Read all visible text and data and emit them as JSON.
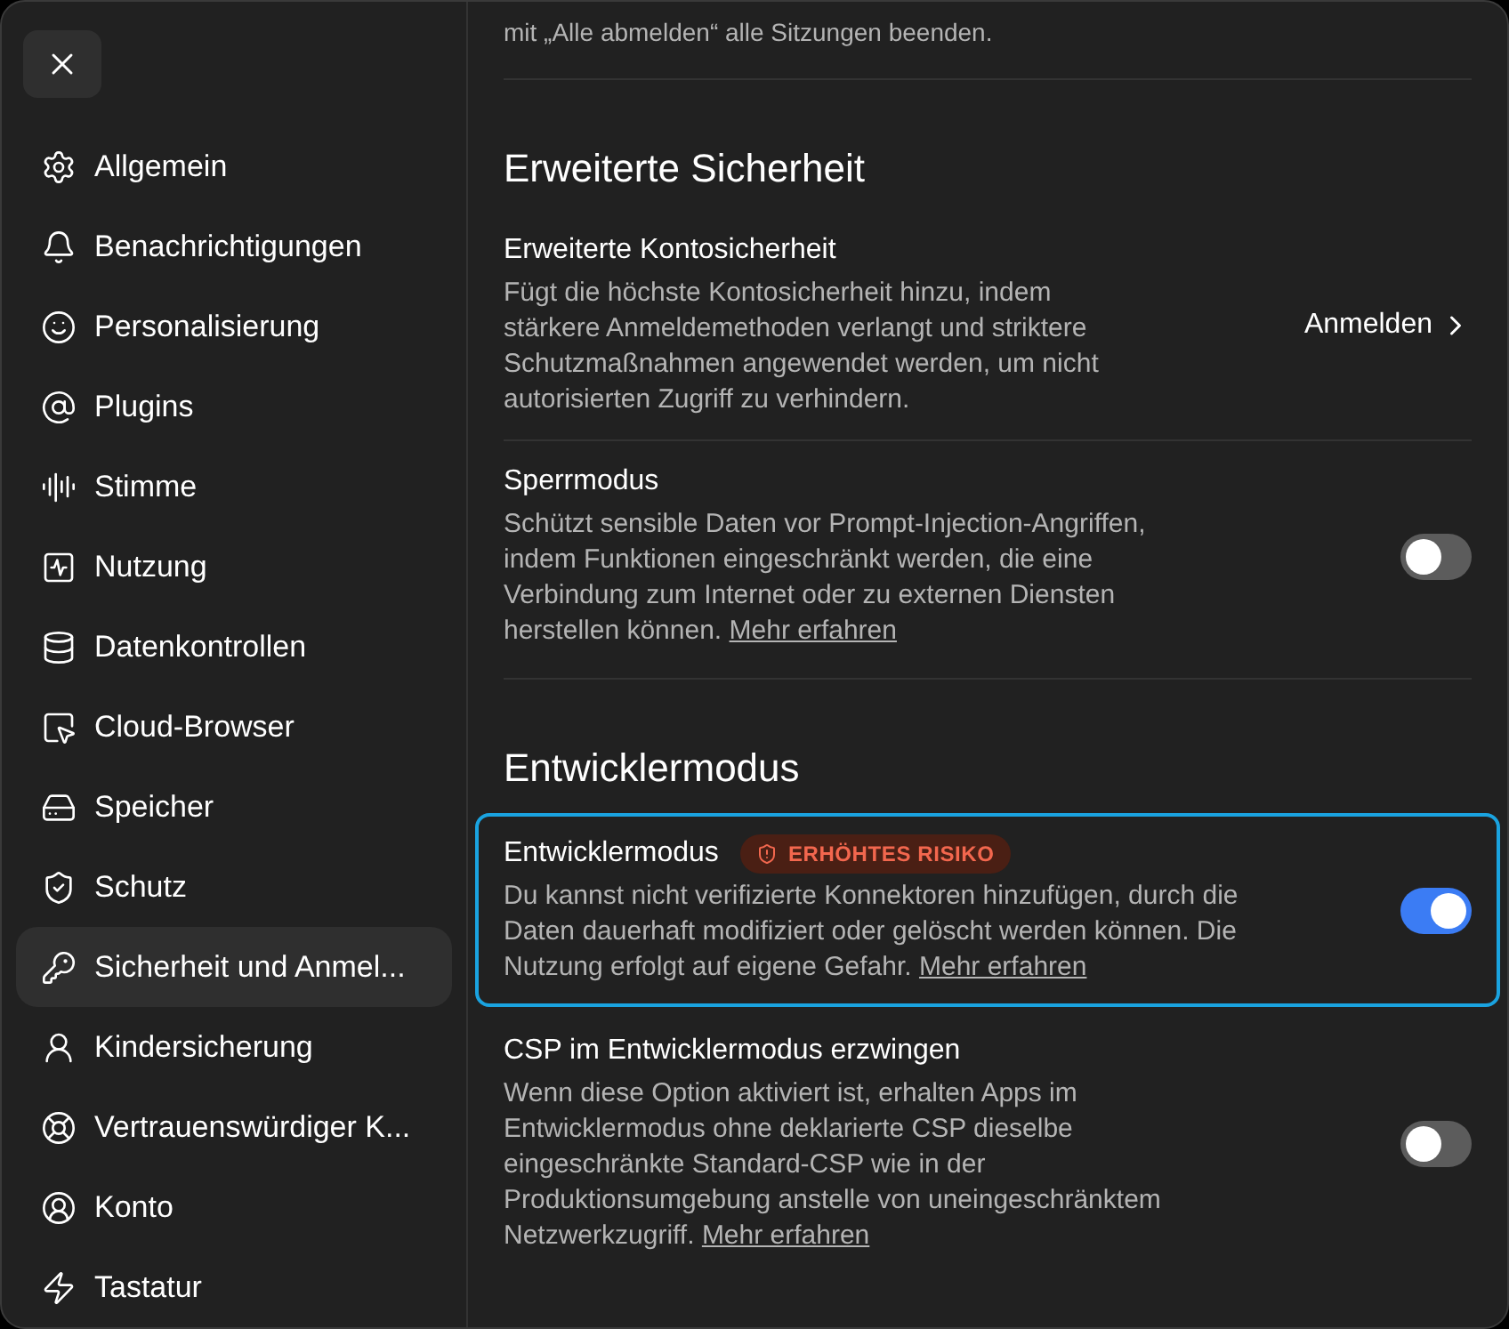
{
  "sidebar": {
    "items": [
      {
        "label": "Allgemein",
        "selected": false
      },
      {
        "label": "Benachrichtigungen",
        "selected": false
      },
      {
        "label": "Personalisierung",
        "selected": false
      },
      {
        "label": "Plugins",
        "selected": false
      },
      {
        "label": "Stimme",
        "selected": false
      },
      {
        "label": "Nutzung",
        "selected": false
      },
      {
        "label": "Datenkontrollen",
        "selected": false
      },
      {
        "label": "Cloud-Browser",
        "selected": false
      },
      {
        "label": "Speicher",
        "selected": false
      },
      {
        "label": "Schutz",
        "selected": false
      },
      {
        "label": "Sicherheit und Anmel...",
        "selected": true
      },
      {
        "label": "Kindersicherung",
        "selected": false
      },
      {
        "label": "Vertrauenswürdiger K...",
        "selected": false
      },
      {
        "label": "Konto",
        "selected": false
      },
      {
        "label": "Tastatur",
        "selected": false
      }
    ]
  },
  "top_note": "mit „Alle abmelden“ alle Sitzungen beenden.",
  "sections": [
    {
      "heading": "Erweiterte Sicherheit",
      "settings": [
        {
          "kind": "link",
          "title": "Erweiterte Kontosicherheit",
          "description": "Fügt die höchste Kontosicherheit hinzu, indem stärkere Anmeldemethoden verlangt und striktere Schutzmaßnahmen angewendet werden, um nicht autorisierten Zugriff zu verhindern.",
          "action_label": "Anmelden",
          "highlighted": false
        },
        {
          "kind": "toggle",
          "title": "Sperrmodus",
          "description": "Schützt sensible Daten vor Prompt-Injection-Angriffen, indem Funktionen eingeschränkt werden, die eine Verbindung zum Internet oder zu externen Diensten herstellen können.",
          "link": "Mehr erfahren",
          "on": false,
          "highlighted": false
        }
      ]
    },
    {
      "heading": "Entwicklermodus",
      "settings": [
        {
          "kind": "toggle",
          "title": "Entwicklermodus",
          "badge": "ERHÖHTES RISIKO",
          "description": "Du kannst nicht verifizierte Konnektoren hinzufügen, durch die Daten dauerhaft modifiziert oder gelöscht werden können. Die Nutzung erfolgt auf eigene Gefahr.",
          "link": "Mehr erfahren",
          "on": true,
          "highlighted": true
        },
        {
          "kind": "toggle",
          "title": "CSP im Entwicklermodus erzwingen",
          "description": "Wenn diese Option aktiviert ist, erhalten Apps im Entwicklermodus ohne deklarierte CSP dieselbe eingeschränkte Standard-CSP wie in der Produktionsumgebung anstelle von uneingeschränktem Netzwerkzugriff.",
          "link": "Mehr erfahren",
          "on": false,
          "highlighted": false
        }
      ]
    }
  ]
}
